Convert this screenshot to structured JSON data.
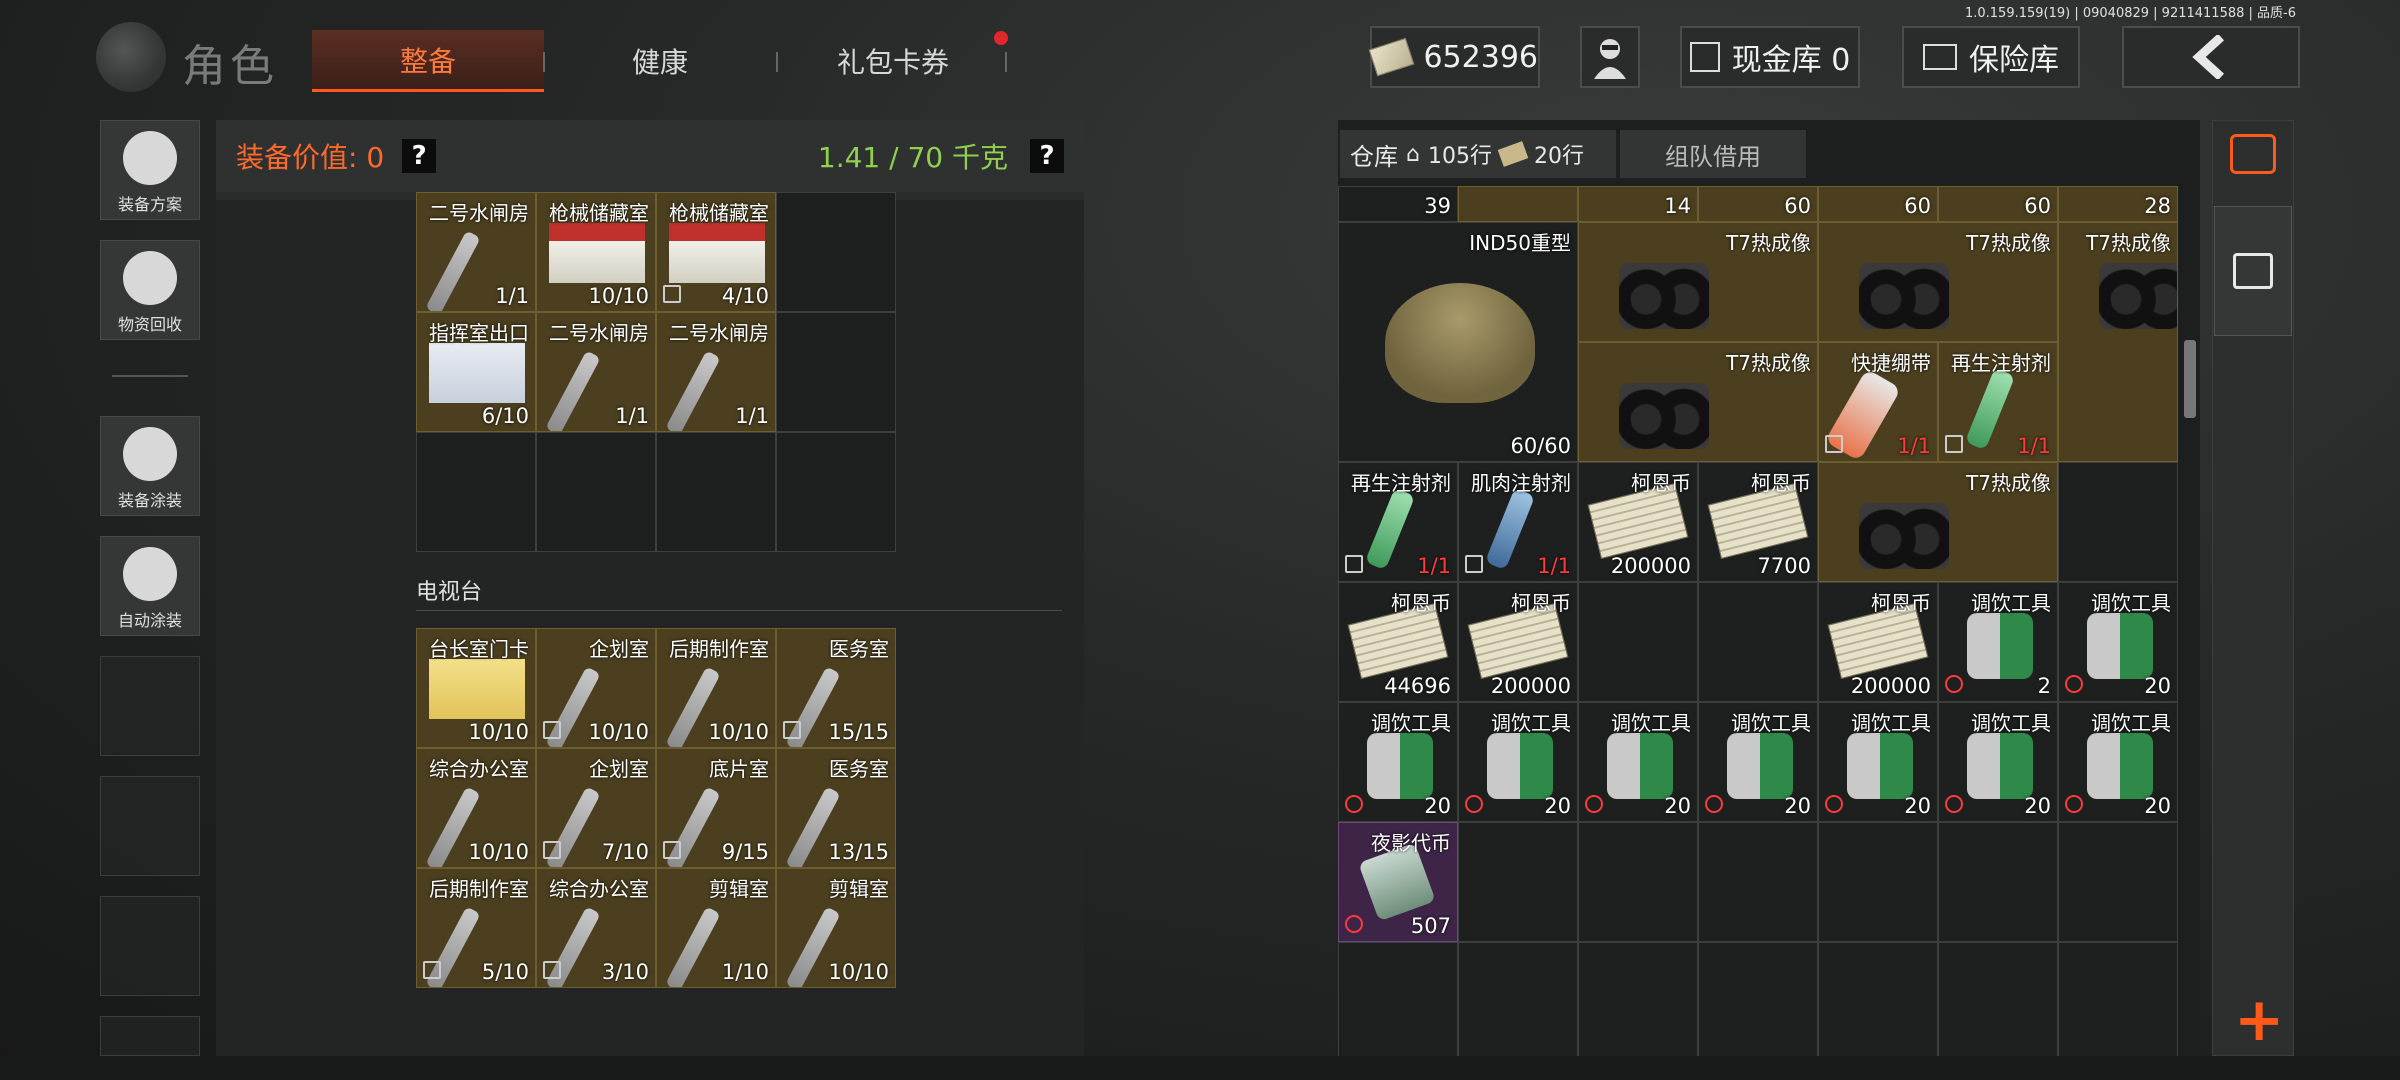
{
  "version": "1.0.159.159(19) | 09040829 | 9211411588 | 品质-6",
  "header": {
    "title": "角色",
    "tabs": [
      {
        "label": "整备",
        "active": true
      },
      {
        "label": "健康",
        "active": false
      },
      {
        "label": "礼包卡券",
        "active": false,
        "badge": true
      }
    ],
    "money": "652396",
    "cash_vault": "现金库 0",
    "insurance": "保险库"
  },
  "sidebar": {
    "items": [
      {
        "label": "装备方案",
        "icon": "soldier-loadout-icon"
      },
      {
        "label": "物资回收",
        "icon": "recycle-face-icon"
      },
      {
        "label": "装备涂装",
        "icon": "helmet-paint-icon"
      },
      {
        "label": "自动涂装",
        "icon": "brush-gear-icon"
      }
    ]
  },
  "equipment": {
    "value_label": "装备价值: 0",
    "weight": "1.41 / 70 千克",
    "help": "?",
    "top_items": [
      {
        "name": "二号水闸房",
        "count": "1/1",
        "type": "key"
      },
      {
        "name": "枪械储藏室",
        "count": "10/10",
        "type": "card"
      },
      {
        "name": "枪械储藏室",
        "count": "4/10",
        "type": "card",
        "flag": "gray"
      },
      {
        "name": "",
        "count": "",
        "type": ""
      },
      {
        "name": "指挥室出口",
        "count": "6/10",
        "type": "card-blue"
      },
      {
        "name": "二号水闸房",
        "count": "1/1",
        "type": "key"
      },
      {
        "name": "二号水闸房",
        "count": "1/1",
        "type": "key"
      },
      {
        "name": "",
        "count": "",
        "type": ""
      },
      {
        "name": "",
        "count": "",
        "type": ""
      },
      {
        "name": "",
        "count": "",
        "type": ""
      },
      {
        "name": "",
        "count": "",
        "type": ""
      },
      {
        "name": "",
        "count": "",
        "type": ""
      }
    ],
    "section_title": "电视台",
    "tv_items": [
      {
        "name": "台长室门卡",
        "count": "10/10",
        "type": "card-yellow"
      },
      {
        "name": "企划室",
        "count": "10/10",
        "type": "key",
        "flag": "gray"
      },
      {
        "name": "后期制作室",
        "count": "10/10",
        "type": "key"
      },
      {
        "name": "医务室",
        "count": "15/15",
        "type": "key",
        "flag": "gray"
      },
      {
        "name": "综合办公室",
        "count": "10/10",
        "type": "key"
      },
      {
        "name": "企划室",
        "count": "7/10",
        "type": "key",
        "flag": "gray"
      },
      {
        "name": "底片室",
        "count": "9/15",
        "type": "key",
        "flag": "gray"
      },
      {
        "name": "医务室",
        "count": "13/15",
        "type": "key"
      },
      {
        "name": "后期制作室",
        "count": "5/10",
        "type": "key",
        "flag": "gray"
      },
      {
        "name": "综合办公室",
        "count": "3/10",
        "type": "key",
        "flag": "gray"
      },
      {
        "name": "剪辑室",
        "count": "1/10",
        "type": "key"
      },
      {
        "name": "剪辑室",
        "count": "10/10",
        "type": "key"
      }
    ]
  },
  "warehouse": {
    "tab_label": "仓库",
    "rows_home": "105行",
    "rows_money": "20行",
    "team_tab": "组队借用",
    "partial_row": [
      "39",
      "",
      "14",
      "60",
      "60",
      "60",
      "28"
    ],
    "items": [
      {
        "name": "IND50重型",
        "count": "60/60",
        "type": "helmet",
        "col": 1,
        "row": 1,
        "cs": 2,
        "rs": 2
      },
      {
        "name": "T7热成像",
        "count": "",
        "type": "nvg",
        "col": 3,
        "row": 1,
        "cs": 2,
        "rs": 1,
        "gold": true
      },
      {
        "name": "T7热成像",
        "count": "",
        "type": "nvg",
        "col": 5,
        "row": 1,
        "cs": 2,
        "rs": 1,
        "gold": true
      },
      {
        "name": "T7热成像",
        "count": "",
        "type": "nvg-tall",
        "col": 7,
        "row": 1,
        "cs": 1,
        "rs": 2,
        "gold": true
      },
      {
        "name": "T7热成像",
        "count": "",
        "type": "nvg",
        "col": 3,
        "row": 2,
        "cs": 2,
        "rs": 1,
        "gold": true
      },
      {
        "name": "快捷绷带",
        "count": "1/1",
        "type": "band",
        "col": 5,
        "row": 2,
        "cs": 1,
        "rs": 1,
        "gold": true,
        "red": true,
        "flag": "gray"
      },
      {
        "name": "再生注射剂",
        "count": "1/1",
        "type": "syr",
        "col": 6,
        "row": 2,
        "cs": 1,
        "rs": 1,
        "gold": true,
        "red": true,
        "flag": "gray"
      },
      {
        "name": "再生注射剂",
        "count": "1/1",
        "type": "syr",
        "col": 1,
        "row": 3,
        "cs": 1,
        "rs": 1,
        "red": true,
        "flag": "gray"
      },
      {
        "name": "肌肉注射剂",
        "count": "1/1",
        "type": "syr-blue",
        "col": 2,
        "row": 3,
        "cs": 1,
        "rs": 1,
        "red": true,
        "flag": "gray"
      },
      {
        "name": "柯恩币",
        "count": "200000",
        "type": "money",
        "col": 3,
        "row": 3,
        "cs": 1,
        "rs": 1
      },
      {
        "name": "柯恩币",
        "count": "7700",
        "type": "money",
        "col": 4,
        "row": 3,
        "cs": 1,
        "rs": 1
      },
      {
        "name": "T7热成像",
        "count": "",
        "type": "nvg",
        "col": 5,
        "row": 3,
        "cs": 2,
        "rs": 1,
        "gold": true
      },
      {
        "name": "柯恩币",
        "count": "44696",
        "type": "money",
        "col": 1,
        "row": 4,
        "cs": 1,
        "rs": 1
      },
      {
        "name": "柯恩币",
        "count": "200000",
        "type": "money",
        "col": 2,
        "row": 4,
        "cs": 1,
        "rs": 1
      },
      {
        "name": "柯恩币",
        "count": "200000",
        "type": "money",
        "col": 5,
        "row": 4,
        "cs": 1,
        "rs": 1
      },
      {
        "name": "调饮工具",
        "count": "2",
        "type": "kit",
        "col": 6,
        "row": 4,
        "cs": 1,
        "rs": 1,
        "flag": "clock"
      },
      {
        "name": "调饮工具",
        "count": "20",
        "type": "kit",
        "col": 7,
        "row": 4,
        "cs": 1,
        "rs": 1,
        "flag": "clock"
      },
      {
        "name": "调饮工具",
        "count": "20",
        "type": "kit",
        "col": 1,
        "row": 5,
        "cs": 1,
        "rs": 1,
        "flag": "clock"
      },
      {
        "name": "调饮工具",
        "count": "20",
        "type": "kit",
        "col": 2,
        "row": 5,
        "cs": 1,
        "rs": 1,
        "flag": "clock"
      },
      {
        "name": "调饮工具",
        "count": "20",
        "type": "kit",
        "col": 3,
        "row": 5,
        "cs": 1,
        "rs": 1,
        "flag": "clock"
      },
      {
        "name": "调饮工具",
        "count": "20",
        "type": "kit",
        "col": 4,
        "row": 5,
        "cs": 1,
        "rs": 1,
        "flag": "clock"
      },
      {
        "name": "调饮工具",
        "count": "20",
        "type": "kit",
        "col": 5,
        "row": 5,
        "cs": 1,
        "rs": 1,
        "flag": "clock"
      },
      {
        "name": "调饮工具",
        "count": "20",
        "type": "kit",
        "col": 6,
        "row": 5,
        "cs": 1,
        "rs": 1,
        "flag": "clock"
      },
      {
        "name": "调饮工具",
        "count": "20",
        "type": "kit",
        "col": 7,
        "row": 5,
        "cs": 1,
        "rs": 1,
        "flag": "clock"
      },
      {
        "name": "夜影代币",
        "count": "507",
        "type": "token",
        "col": 1,
        "row": 6,
        "cs": 1,
        "rs": 1,
        "purple": true,
        "flag": "clock"
      }
    ]
  },
  "colors": {
    "accent": "#ff5a1a",
    "weight_green": "#8fd14f",
    "gold_cell": "#4b3f1f"
  }
}
